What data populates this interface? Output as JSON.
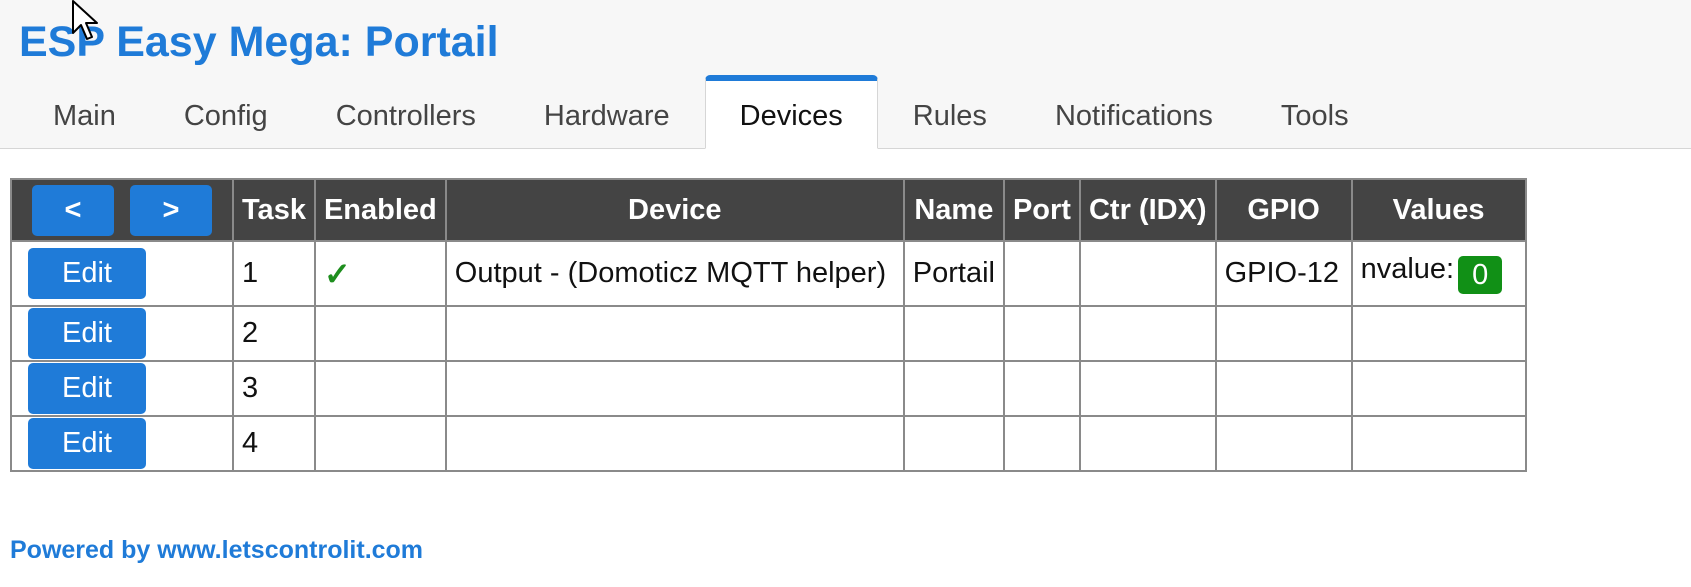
{
  "app": {
    "title": "ESP Easy Mega: Portail"
  },
  "tabs": [
    {
      "label": "Main"
    },
    {
      "label": "Config"
    },
    {
      "label": "Controllers"
    },
    {
      "label": "Hardware"
    },
    {
      "label": "Devices"
    },
    {
      "label": "Rules"
    },
    {
      "label": "Notifications"
    },
    {
      "label": "Tools"
    }
  ],
  "active_tab": "Devices",
  "table": {
    "prev_label": "<",
    "next_label": ">",
    "headers": [
      "Task",
      "Enabled",
      "Device",
      "Name",
      "Port",
      "Ctr (IDX)",
      "GPIO",
      "Values"
    ],
    "edit_label": "Edit",
    "rows": [
      {
        "task": "1",
        "enabled": "✓",
        "device": "Output - (Domoticz MQTT helper)",
        "name": "Portail",
        "port": "",
        "ctr": "",
        "gpio": "GPIO-12",
        "value_label": "nvalue:",
        "value": "0"
      },
      {
        "task": "2",
        "enabled": "",
        "device": "",
        "name": "",
        "port": "",
        "ctr": "",
        "gpio": "",
        "value_label": "",
        "value": ""
      },
      {
        "task": "3",
        "enabled": "",
        "device": "",
        "name": "",
        "port": "",
        "ctr": "",
        "gpio": "",
        "value_label": "",
        "value": ""
      },
      {
        "task": "4",
        "enabled": "",
        "device": "",
        "name": "",
        "port": "",
        "ctr": "",
        "gpio": "",
        "value_label": "",
        "value": ""
      }
    ]
  },
  "footer": {
    "text": "Powered by www.letscontrolit.com"
  },
  "colors": {
    "accent": "#1f7bd8",
    "header_bg": "#444444",
    "value_badge": "#119016",
    "check": "#1e8e1e"
  },
  "icons": {
    "enabled": "check-icon",
    "cursor": "mouse-pointer-icon"
  }
}
